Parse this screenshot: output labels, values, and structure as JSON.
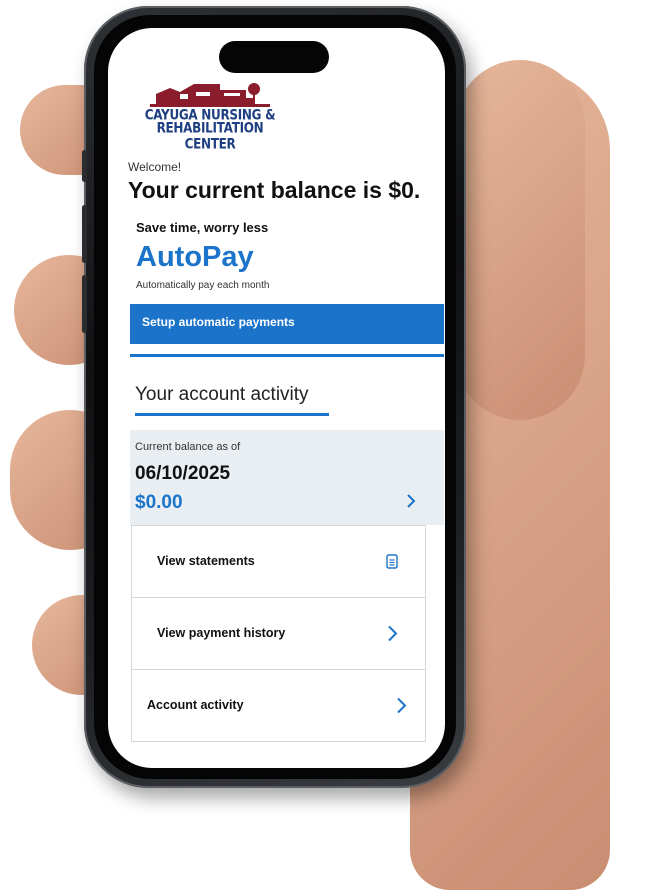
{
  "brand": {
    "line1": "CAYUGA NURSING &",
    "line2": "REHABILITATION CENTER",
    "primary_color": "#1e3f82",
    "building_color": "#8a1c2b"
  },
  "welcome": "Welcome!",
  "balance_heading": "Your current balance is $0.",
  "autopay": {
    "tagline": "Save time, worry less",
    "title": "AutoPay",
    "subtitle": "Automatically pay each month",
    "button_label": "Setup automatic payments",
    "accent_color": "#1b74c9"
  },
  "activity": {
    "title": "Your account activity",
    "balance_label": "Current balance as of",
    "balance_date": "06/10/2025",
    "balance_amount": "$0.00"
  },
  "menu": [
    {
      "label": "View statements",
      "icon": "document-icon"
    },
    {
      "label": "View payment history",
      "icon": "chevron-right-icon"
    },
    {
      "label": "Account activity",
      "icon": "chevron-right-icon"
    }
  ]
}
